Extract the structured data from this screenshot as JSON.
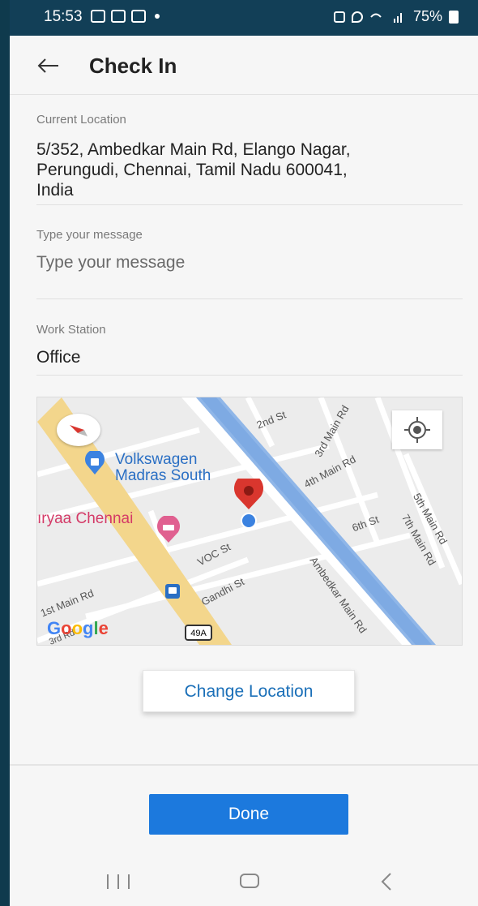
{
  "status_bar": {
    "time": "15:53",
    "battery": "75%"
  },
  "app_bar": {
    "title": "Check In",
    "back_icon": "arrow-left-icon"
  },
  "current_location": {
    "label": "Current Location",
    "address_line1": "5/352, Ambedkar Main Rd, Elango Nagar,",
    "address_line2": "Perungudi, Chennai, Tamil Nadu 600041,",
    "address_line3": "India"
  },
  "message": {
    "label": "Type your message",
    "placeholder": "Type your message"
  },
  "work_station": {
    "label": "Work Station",
    "value": "Office"
  },
  "map": {
    "poi_1": "Volkswagen",
    "poi_1b": "Madras South",
    "poi_2": "ıryaa Chennai",
    "streets": {
      "s1": "2nd St",
      "s2": "3rd Main Rd",
      "s3": "4th Main Rd",
      "s4": "5th Main Rd",
      "s5": "6th St",
      "s6": "7th Main Rd",
      "s7": "VOC St",
      "s8": "Gandhi St",
      "s9": "1st Main Rd",
      "s10": "3rd Rd",
      "s11": "Ambedkar Main Rd"
    },
    "highway": "49A",
    "logo": "Google"
  },
  "change_location_label": "Change Location",
  "done_label": "Done",
  "colors": {
    "primary": "#1c79dd",
    "link": "#1a6fb8",
    "marker": "#d9362e"
  }
}
